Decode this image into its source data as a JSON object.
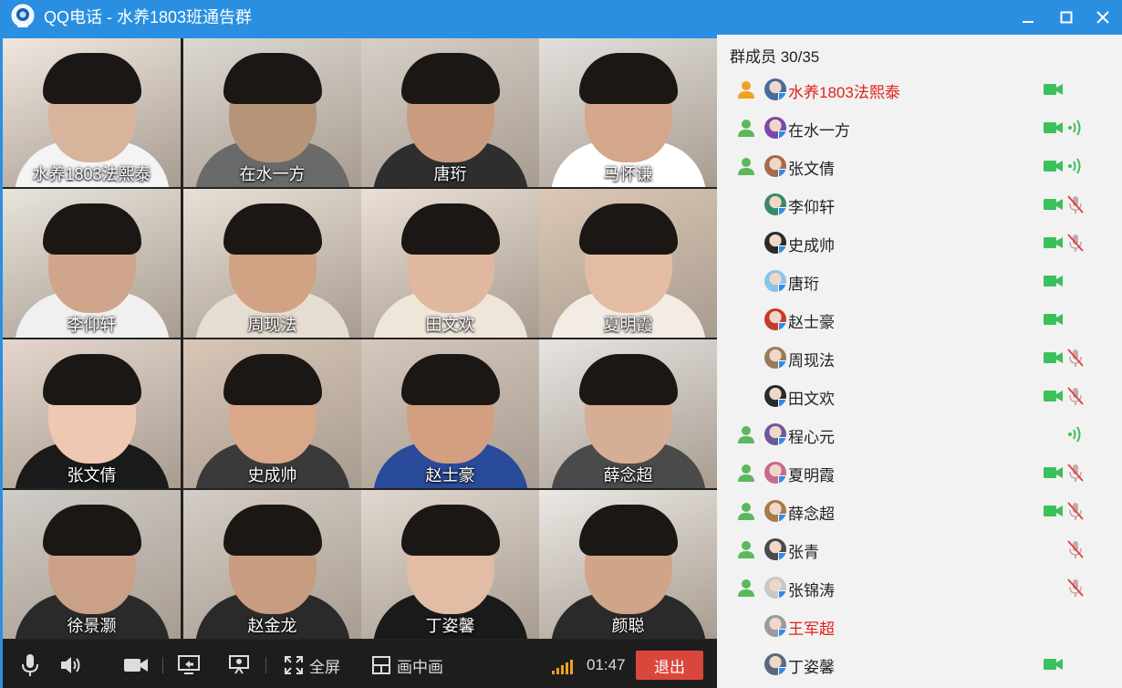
{
  "window": {
    "app_name": "QQ电话",
    "separator": " - ",
    "group_name": "水养1803班通告群"
  },
  "video_grid": [
    {
      "name": "水养1803法熙泰"
    },
    {
      "name": "在水一方"
    },
    {
      "name": "唐珩"
    },
    {
      "name": "马怀谦"
    },
    {
      "name": "李仰轩"
    },
    {
      "name": "周现法"
    },
    {
      "name": "田文欢"
    },
    {
      "name": "夏明霞"
    },
    {
      "name": "张文倩"
    },
    {
      "name": "史成帅"
    },
    {
      "name": "赵士豪"
    },
    {
      "name": "薛念超"
    },
    {
      "name": "徐景灏"
    },
    {
      "name": "赵金龙"
    },
    {
      "name": "丁姿馨"
    },
    {
      "name": "颜聪"
    }
  ],
  "toolbar": {
    "fullscreen_label": "全屏",
    "pip_label": "画中画",
    "timer": "01:47",
    "exit_label": "退出"
  },
  "member_panel": {
    "count_label": "群成员 30/35"
  },
  "members": [
    {
      "name": "水养1803法熙泰",
      "role_icon": "gold",
      "highlight": true,
      "camera": true,
      "mic": "none"
    },
    {
      "name": "在水一方",
      "role_icon": "green",
      "highlight": false,
      "camera": true,
      "mic": "speaking"
    },
    {
      "name": "张文倩",
      "role_icon": "green",
      "highlight": false,
      "camera": true,
      "mic": "speaking"
    },
    {
      "name": "李仰轩",
      "role_icon": "none",
      "highlight": false,
      "camera": true,
      "mic": "muted"
    },
    {
      "name": "史成帅",
      "role_icon": "none",
      "highlight": false,
      "camera": true,
      "mic": "muted"
    },
    {
      "name": "唐珩",
      "role_icon": "none",
      "highlight": false,
      "camera": true,
      "mic": "none"
    },
    {
      "name": "赵士豪",
      "role_icon": "none",
      "highlight": false,
      "camera": true,
      "mic": "none"
    },
    {
      "name": "周现法",
      "role_icon": "none",
      "highlight": false,
      "camera": true,
      "mic": "muted"
    },
    {
      "name": "田文欢",
      "role_icon": "none",
      "highlight": false,
      "camera": true,
      "mic": "muted"
    },
    {
      "name": "程心元",
      "role_icon": "green",
      "highlight": false,
      "camera": false,
      "mic": "speaking"
    },
    {
      "name": "夏明霞",
      "role_icon": "green",
      "highlight": false,
      "camera": true,
      "mic": "muted"
    },
    {
      "name": "薛念超",
      "role_icon": "green",
      "highlight": false,
      "camera": true,
      "mic": "muted"
    },
    {
      "name": "张青",
      "role_icon": "green",
      "highlight": false,
      "camera": false,
      "mic": "muted"
    },
    {
      "name": "张锦涛",
      "role_icon": "green",
      "highlight": false,
      "camera": false,
      "mic": "muted"
    },
    {
      "name": "王军超",
      "role_icon": "none",
      "highlight": true,
      "camera": false,
      "mic": "none"
    },
    {
      "name": "丁姿馨",
      "role_icon": "none",
      "highlight": false,
      "camera": true,
      "mic": "none"
    }
  ],
  "colors": {
    "titlebar": "#2a8fe0",
    "panel": "#f2f2f2",
    "toolbar": "#1d1d1d",
    "exit": "#d9463c",
    "camera_green": "#3cc05a",
    "muted_red": "#e04040",
    "highlight_red": "#e0201a",
    "signal": "#f0a020"
  }
}
